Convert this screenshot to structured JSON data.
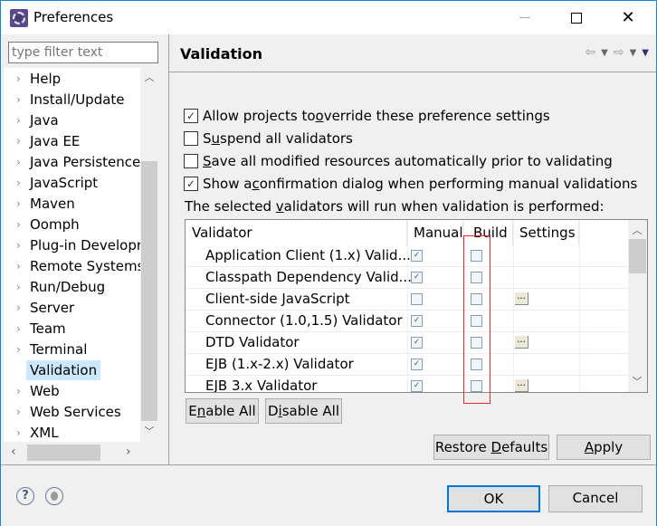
{
  "window": {
    "title": "Preferences"
  },
  "filter": {
    "placeholder": "type filter text"
  },
  "tree": {
    "items": [
      {
        "label": "Help",
        "expandable": true
      },
      {
        "label": "Install/Update",
        "expandable": true
      },
      {
        "label": "Java",
        "expandable": true
      },
      {
        "label": "Java EE",
        "expandable": true
      },
      {
        "label": "Java Persistence",
        "expandable": true
      },
      {
        "label": "JavaScript",
        "expandable": true
      },
      {
        "label": "Maven",
        "expandable": true
      },
      {
        "label": "Oomph",
        "expandable": true
      },
      {
        "label": "Plug-in Developr",
        "expandable": true
      },
      {
        "label": "Remote Systems",
        "expandable": true
      },
      {
        "label": "Run/Debug",
        "expandable": true
      },
      {
        "label": "Server",
        "expandable": true
      },
      {
        "label": "Team",
        "expandable": true
      },
      {
        "label": "Terminal",
        "expandable": true
      },
      {
        "label": "Validation",
        "expandable": false,
        "selected": true
      },
      {
        "label": "Web",
        "expandable": true
      },
      {
        "label": "Web Services",
        "expandable": true
      },
      {
        "label": "XML",
        "expandable": true
      }
    ]
  },
  "page": {
    "title": "Validation",
    "options": [
      {
        "pre": "Allow projects to ",
        "mn": "o",
        "post": "verride these preference settings",
        "checked": true
      },
      {
        "pre": "S",
        "mn": "u",
        "post": "spend all validators",
        "checked": false
      },
      {
        "pre": "",
        "mn": "S",
        "post": "ave all modified resources automatically prior to validating",
        "checked": false
      },
      {
        "pre": "Show a ",
        "mn": "c",
        "post": "onfirmation dialog when performing manual validations",
        "checked": true
      }
    ],
    "info": {
      "pre": "The selected ",
      "mn": "v",
      "post": "alidators will run when validation is performed:"
    },
    "table": {
      "columns": [
        "Validator",
        "Manual",
        "Build",
        "Settings"
      ],
      "rows": [
        {
          "name": "Application Client (1.x) Valid...",
          "manual": true,
          "build": false,
          "settings": false
        },
        {
          "name": "Classpath Dependency Valid...",
          "manual": true,
          "build": false,
          "settings": false
        },
        {
          "name": "Client-side JavaScript",
          "manual": false,
          "build": false,
          "settings": true
        },
        {
          "name": "Connector (1.0,1.5) Validator",
          "manual": true,
          "build": false,
          "settings": false
        },
        {
          "name": "DTD Validator",
          "manual": true,
          "build": false,
          "settings": true
        },
        {
          "name": "EJB (1.x-2.x) Validator",
          "manual": true,
          "build": false,
          "settings": false
        },
        {
          "name": "EJB 3.x Validator",
          "manual": true,
          "build": false,
          "settings": true
        }
      ],
      "settings_button": "..."
    },
    "enable_all": {
      "pre": "E",
      "mn": "n",
      "post": "able All"
    },
    "disable_all": {
      "pre": "D",
      "mn": "i",
      "post": "sable All"
    },
    "restore_defaults": {
      "pre": "Restore ",
      "mn": "D",
      "post": "efaults"
    },
    "apply": {
      "pre": "",
      "mn": "A",
      "post": "pply"
    }
  },
  "footer": {
    "ok": "OK",
    "cancel": "Cancel"
  },
  "colors": {
    "accent": "#0078d7",
    "selection": "#cce8ff",
    "highlight_box": "#e03030"
  }
}
